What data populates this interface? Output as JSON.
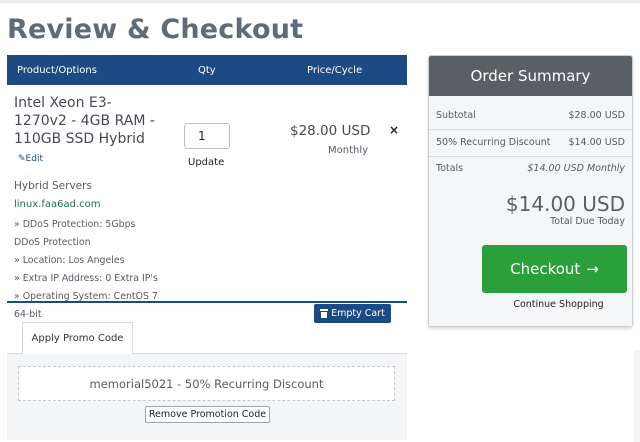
{
  "page": {
    "title": "Review & Checkout"
  },
  "cart": {
    "headers": {
      "product": "Product/Options",
      "qty": "Qty",
      "price": "Price/Cycle"
    },
    "item": {
      "name": "Intel Xeon E3-1270v2 - 4GB RAM - 110GB SSD Hybrid",
      "edit_label": "Edit",
      "group": "Hybrid Servers",
      "domain": "linux.faa6ad.com",
      "options": [
        "» DDoS Protection: 5Gbps DDoS Protection",
        "» Location: Los Angeles",
        "» Extra IP Address: 0 Extra IP's",
        "» Operating System: CentOS 7 64-bit"
      ],
      "qty": "1",
      "update_label": "Update",
      "price": "$28.00 USD",
      "cycle": "Monthly",
      "remove_symbol": "×"
    },
    "empty_cart_label": "Empty Cart"
  },
  "promo": {
    "tab_label": "Apply Promo Code",
    "applied_text": "memorial5021 - 50% Recurring Discount",
    "remove_label": "Remove Promotion Code"
  },
  "summary": {
    "title": "Order Summary",
    "subtotal_label": "Subtotal",
    "subtotal_value": "$28.00 USD",
    "discount_label": "50% Recurring Discount",
    "discount_value": "$14.00 USD",
    "totals_label": "Totals",
    "totals_value": "$14.00 USD Monthly",
    "total_due_amount": "$14.00 USD",
    "total_due_label": "Total Due Today",
    "checkout_label": "Checkout",
    "checkout_icon": "→",
    "continue_label": "Continue Shopping"
  },
  "colors": {
    "header_blue": "#1c4b84",
    "checkout_green": "#2a9f3a",
    "summary_header_gray": "#5a5f64",
    "title_gray": "#5f6b78"
  }
}
